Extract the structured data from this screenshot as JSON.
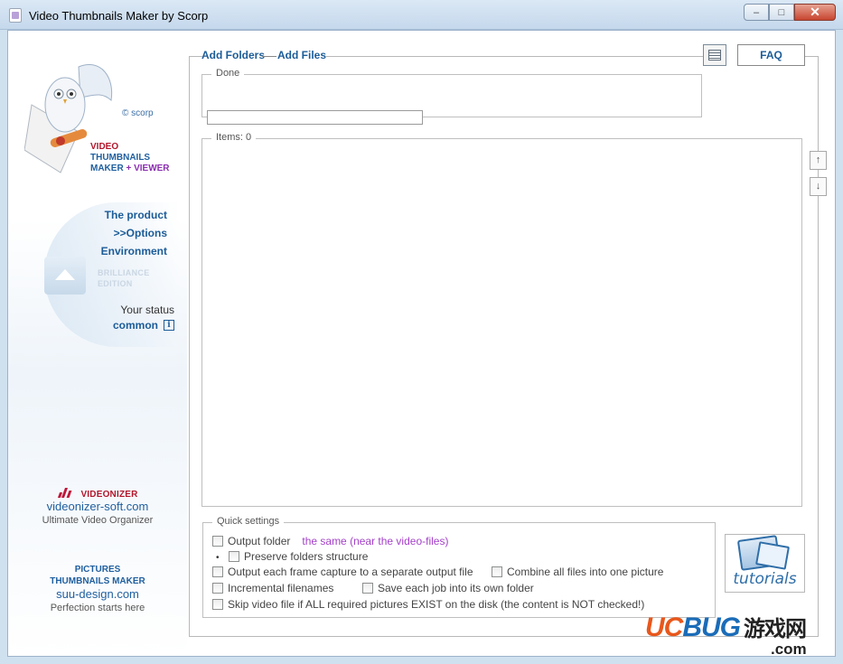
{
  "window": {
    "title": "Video Thumbnails Maker by Scorp",
    "minimize": "–",
    "maximize": "□",
    "close": "✕"
  },
  "sidebar": {
    "copyright": "© scorp",
    "brand": {
      "line1": "VIDEO",
      "line2": "THUMBNAILS",
      "line3a": "MAKER",
      "line3b": "+ VIEWER"
    },
    "nav": [
      {
        "label": "The product"
      },
      {
        "label": ">>Options"
      },
      {
        "label": "Environment"
      }
    ],
    "edition": {
      "line1": "BRILLIANCE",
      "line2": "EDITION"
    },
    "status_label": "Your status",
    "status_value": "common",
    "info_glyph": "i",
    "promo1": {
      "name": "VIDEONIZER",
      "site": "videonizer-soft.com",
      "tagline": "Ultimate Video Organizer"
    },
    "promo2": {
      "name1": "PICTURES",
      "name2": "THUMBNAILS MAKER",
      "site": "suu-design.com",
      "tagline": "Perfection starts here"
    }
  },
  "toolbar": {
    "add_folders": "Add Folders",
    "add_files": "Add Files",
    "faq": "FAQ"
  },
  "status_group": {
    "legend": "Done",
    "progress": 0
  },
  "items_group": {
    "legend": "Items: 0",
    "up": "↑",
    "down": "↓"
  },
  "quick_settings": {
    "legend": "Quick settings",
    "output_folder": "Output folder",
    "output_folder_value": "the same (near the video-files)",
    "bullet": "•",
    "preserve_structure": "Preserve folders structure",
    "each_frame": "Output each frame capture to a separate output file",
    "combine_all": "Combine all files into one picture",
    "incremental": "Incremental filenames",
    "own_folder": "Save each job into its own folder",
    "skip_existing": "Skip video file if ALL required pictures EXIST on the disk (the content is NOT checked!)"
  },
  "tutorials": {
    "label": "tutorials"
  },
  "watermark": {
    "uc": "UC",
    "bug": "BUG",
    "cn": "游戏网",
    "com": ".com"
  }
}
